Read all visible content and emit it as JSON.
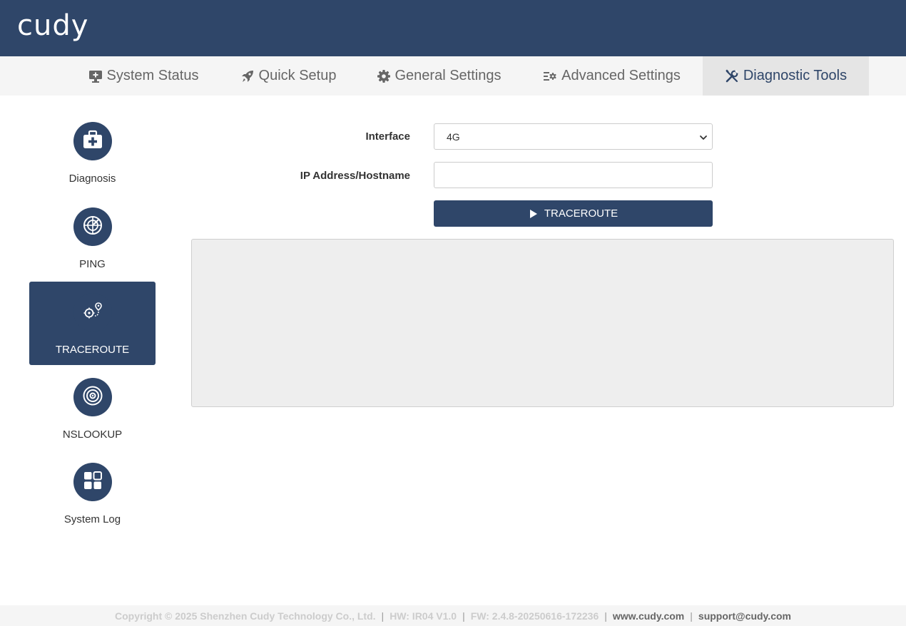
{
  "header": {
    "logo_text": "cudy"
  },
  "nav": {
    "items": [
      {
        "label": "System Status",
        "icon": "monitor-icon"
      },
      {
        "label": "Quick Setup",
        "icon": "rocket-icon"
      },
      {
        "label": "General Settings",
        "icon": "gear-icon"
      },
      {
        "label": "Advanced Settings",
        "icon": "sliders-gear-icon"
      },
      {
        "label": "Diagnostic Tools",
        "icon": "tools-icon",
        "active": true
      }
    ]
  },
  "sidebar": {
    "items": [
      {
        "label": "Diagnosis",
        "icon": "medical-kit-icon"
      },
      {
        "label": "PING",
        "icon": "radar-icon"
      },
      {
        "label": "TRACEROUTE",
        "icon": "route-pin-icon",
        "active": true
      },
      {
        "label": "NSLOOKUP",
        "icon": "target-icon"
      },
      {
        "label": "System Log",
        "icon": "grid-icon"
      }
    ]
  },
  "form": {
    "interface_label": "Interface",
    "interface_value": "4G",
    "host_label": "IP Address/Hostname",
    "host_value": "",
    "button_label": "TRACEROUTE"
  },
  "output": {
    "text": ""
  },
  "footer": {
    "copyright": "Copyright © 2025 Shenzhen Cudy Technology Co., Ltd.",
    "hw": "HW: IR04 V1.0",
    "fw": "FW: 2.4.8-20250616-172236",
    "website": "www.cudy.com",
    "support": "support@cudy.com",
    "separator": "|"
  },
  "colors": {
    "primary": "#2f4669",
    "nav_bg": "#f5f5f5",
    "nav_active_bg": "#e5e5e5",
    "output_bg": "#eeeeee"
  }
}
